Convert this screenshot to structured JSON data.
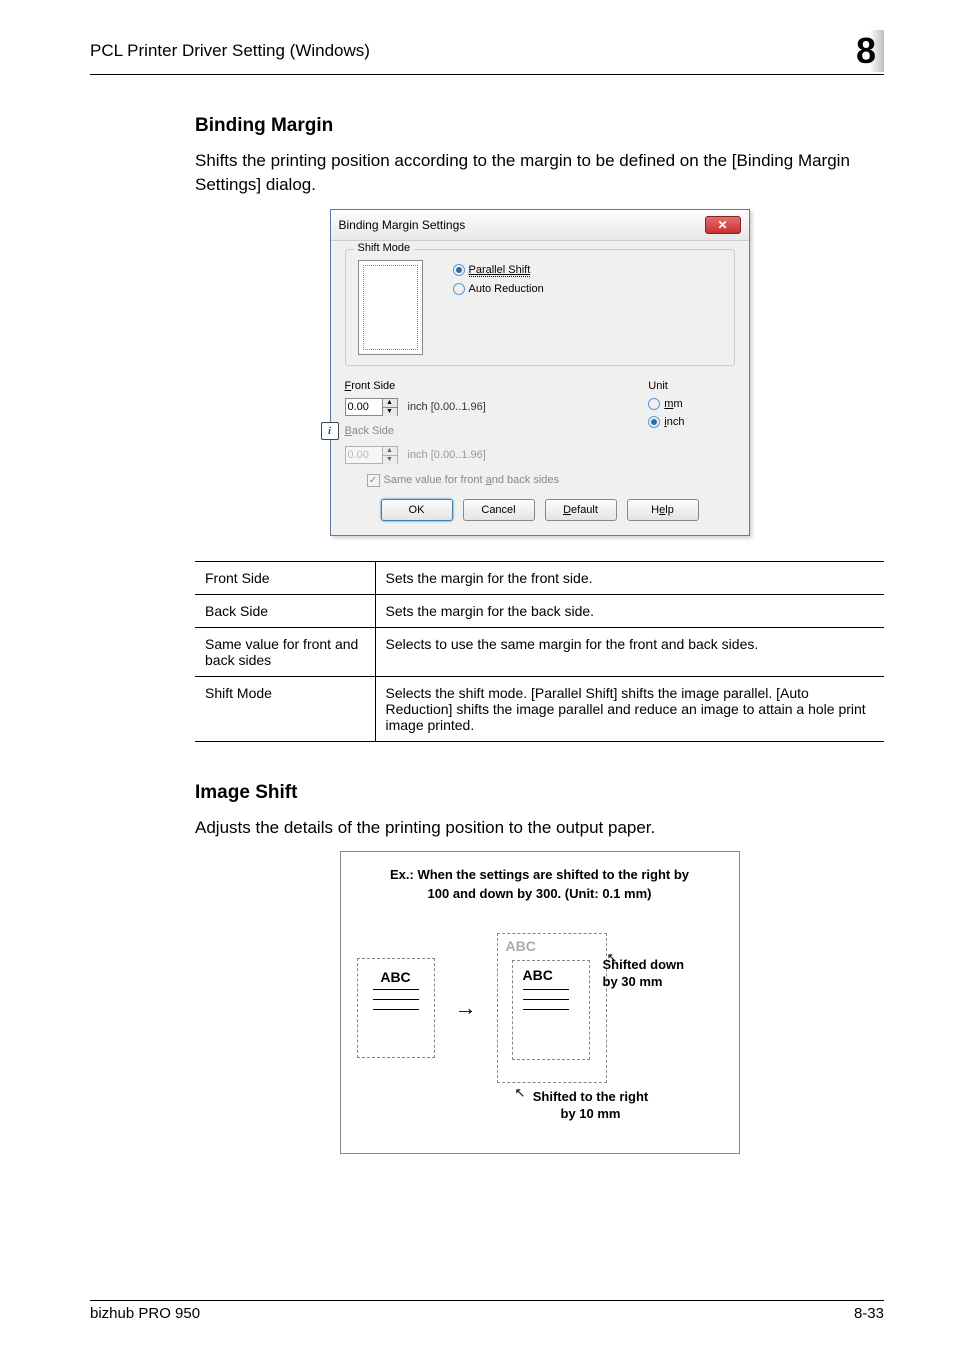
{
  "header": {
    "title": "PCL Printer Driver Setting (Windows)",
    "chapter": "8"
  },
  "sections": {
    "binding_margin": {
      "heading": "Binding Margin",
      "body": "Shifts the printing position according to the margin to be defined on the [Binding Margin Settings] dialog."
    },
    "image_shift": {
      "heading": "Image Shift",
      "body": "Adjusts the details of the printing position to the output paper."
    }
  },
  "dialog": {
    "title": "Binding Margin Settings",
    "fieldset_label": "Shift Mode",
    "radios": {
      "parallel": "Parallel Shift",
      "auto": "Auto Reduction"
    },
    "front_label": "Front Side",
    "back_label": "Back Side",
    "unit_label": "Unit",
    "unit_mm": "mm",
    "unit_inch": "inch",
    "front_value": "0.00",
    "back_value": "0.00",
    "range_text": "inch [0.00..1.96]",
    "same_value_label": "Same value for front and back sides",
    "buttons": {
      "ok": "OK",
      "cancel": "Cancel",
      "default": "Default",
      "help": "Help"
    }
  },
  "table": [
    {
      "name": "Front Side",
      "desc": "Sets the margin for the front side."
    },
    {
      "name": "Back Side",
      "desc": "Sets the margin for the back side."
    },
    {
      "name": "Same value for front and back sides",
      "desc": "Selects to use the same margin for the front and back sides."
    },
    {
      "name": "Shift Mode",
      "desc": "Selects the shift mode. [Parallel Shift] shifts the image parallel. [Auto Reduction] shifts the image parallel and reduce an image to attain a hole print image printed."
    }
  ],
  "illustration": {
    "title_line1": "Ex.:  When the settings are shifted to the right by",
    "title_line2": "100 and down by 300. (Unit: 0.1 mm)",
    "abc": "ABC",
    "anno_down_l1": "Shifted down",
    "anno_down_l2": "by 30 mm",
    "anno_right_l1": "Shifted to the right",
    "anno_right_l2": "by 10 mm"
  },
  "footer": {
    "product": "bizhub PRO 950",
    "page": "8-33"
  }
}
